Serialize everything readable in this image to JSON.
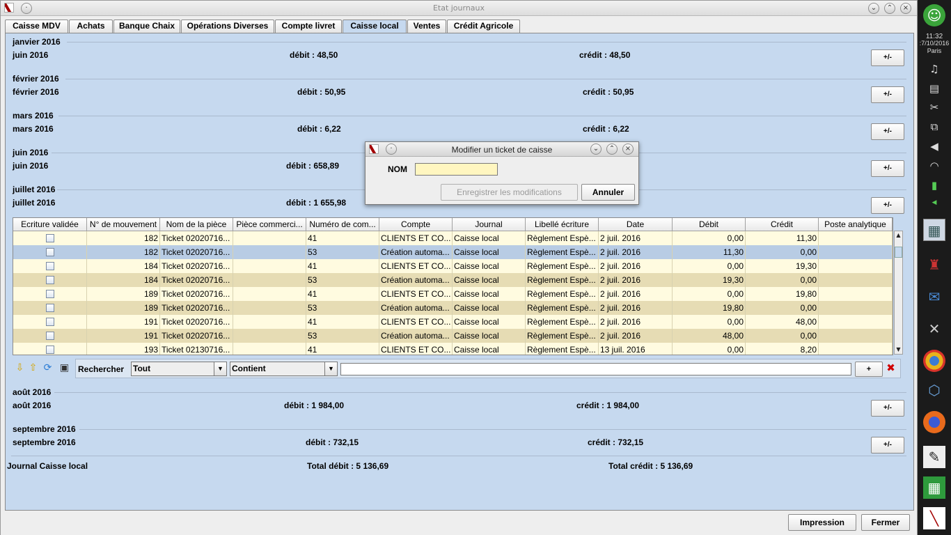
{
  "window": {
    "title": "Etat journaux"
  },
  "tabs": [
    "Caisse MDV",
    "Achats",
    "Banque Chaix",
    "Opérations Diverses",
    "Compte livret",
    "Caisse local",
    "Ventes",
    "Crédit Agricole"
  ],
  "active_tab": "Caisse local",
  "months_top": [
    {
      "header": "janvier 2016",
      "label": "juin 2016",
      "debit": "débit : 48,50",
      "credit": "crédit : 48,50",
      "toggle": "+/-"
    },
    {
      "header": "février 2016",
      "label": "février 2016",
      "debit": "débit : 50,95",
      "credit": "crédit : 50,95",
      "toggle": "+/-"
    },
    {
      "header": "mars 2016",
      "label": "mars 2016",
      "debit": "débit : 6,22",
      "credit": "crédit : 6,22",
      "toggle": "+/-"
    },
    {
      "header": "juin 2016",
      "label": "juin 2016",
      "debit": "débit : 658,89",
      "credit": "",
      "toggle": "+/-"
    },
    {
      "header": "juillet 2016",
      "label": "juillet 2016",
      "debit": "débit : 1 655,98",
      "credit": "",
      "toggle": "+/-"
    }
  ],
  "months_bottom": [
    {
      "header": "août 2016",
      "label": "août 2016",
      "debit": "débit : 1 984,00",
      "credit": "crédit : 1 984,00",
      "toggle": "+/-"
    },
    {
      "header": "septembre 2016",
      "label": "septembre 2016",
      "debit": "débit : 732,15",
      "credit": "crédit : 732,15",
      "toggle": "+/-"
    }
  ],
  "table": {
    "columns": [
      "Ecriture validée",
      "N° de mouvement",
      "Nom de la pièce",
      "Pièce commerci...",
      "Numéro de com...",
      "Compte",
      "Journal",
      "Libellé écriture",
      "Date",
      "Débit",
      "Crédit",
      "Poste analytique"
    ],
    "rows": [
      [
        "",
        "182",
        "Ticket 02020716...",
        "",
        "41",
        "CLIENTS ET CO...",
        "Caisse local",
        "Règlement Espè...",
        "2 juil. 2016",
        "0,00",
        "11,30",
        ""
      ],
      [
        "",
        "182",
        "Ticket 02020716...",
        "",
        "53",
        "Création automa...",
        "Caisse local",
        "Règlement Espè...",
        "2 juil. 2016",
        "11,30",
        "0,00",
        ""
      ],
      [
        "",
        "184",
        "Ticket 02020716...",
        "",
        "41",
        "CLIENTS ET CO...",
        "Caisse local",
        "Règlement Espè...",
        "2 juil. 2016",
        "0,00",
        "19,30",
        ""
      ],
      [
        "",
        "184",
        "Ticket 02020716...",
        "",
        "53",
        "Création automa...",
        "Caisse local",
        "Règlement Espè...",
        "2 juil. 2016",
        "19,30",
        "0,00",
        ""
      ],
      [
        "",
        "189",
        "Ticket 02020716...",
        "",
        "41",
        "CLIENTS ET CO...",
        "Caisse local",
        "Règlement Espè...",
        "2 juil. 2016",
        "0,00",
        "19,80",
        ""
      ],
      [
        "",
        "189",
        "Ticket 02020716...",
        "",
        "53",
        "Création automa...",
        "Caisse local",
        "Règlement Espè...",
        "2 juil. 2016",
        "19,80",
        "0,00",
        ""
      ],
      [
        "",
        "191",
        "Ticket 02020716...",
        "",
        "41",
        "CLIENTS ET CO...",
        "Caisse local",
        "Règlement Espè...",
        "2 juil. 2016",
        "0,00",
        "48,00",
        ""
      ],
      [
        "",
        "191",
        "Ticket 02020716...",
        "",
        "53",
        "Création automa...",
        "Caisse local",
        "Règlement Espè...",
        "2 juil. 2016",
        "48,00",
        "0,00",
        ""
      ],
      [
        "",
        "193",
        "Ticket 02130716...",
        "",
        "41",
        "CLIENTS ET CO...",
        "Caisse local",
        "Règlement Espè...",
        "13 juil. 2016",
        "0,00",
        "8,20",
        ""
      ]
    ]
  },
  "search": {
    "label": "Rechercher",
    "field": "Tout",
    "mode": "Contient",
    "value": "",
    "add": "+",
    "remove_icon": "red-x-icon"
  },
  "totals": {
    "journal": "Journal Caisse local",
    "debit": "Total débit : 5 136,69",
    "credit": "Total crédit : 5 136,69"
  },
  "footer": {
    "print": "Impression",
    "close": "Fermer"
  },
  "dialog": {
    "title": "Modifier un ticket de caisse",
    "nom_label": "NOM",
    "nom_value": "",
    "save": "Enregistrer les modifications",
    "cancel": "Annuler"
  },
  "dock": {
    "time": "11:32",
    "date": ":7/10/2016",
    "place": "Paris"
  },
  "colors": {
    "panel": "#c6d9ef",
    "row_alt": "#e6dcb4",
    "row_base": "#fffbe0",
    "row_selected": "#b8cce4",
    "remove": "#d00000"
  }
}
